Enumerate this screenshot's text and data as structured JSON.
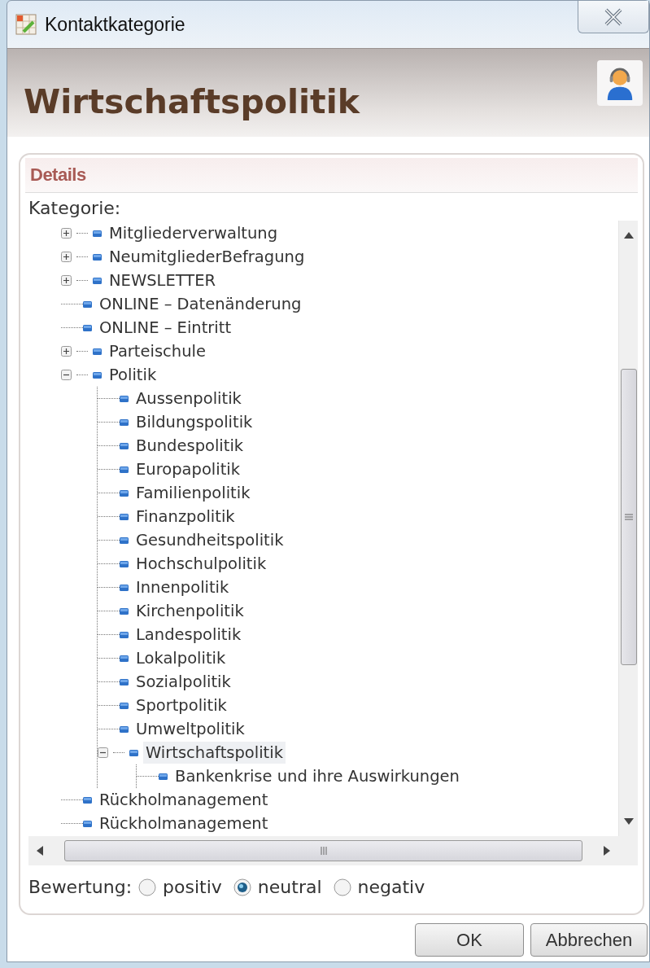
{
  "window": {
    "title": "Kontaktkategorie"
  },
  "header": {
    "title": "Wirtschaftspolitik"
  },
  "panel": {
    "title": "Details"
  },
  "tree": {
    "label": "Kategorie:",
    "items": [
      {
        "label": "Mitgliederverwaltung",
        "kind": "group",
        "expanded": false,
        "selected": false
      },
      {
        "label": "NeumitgliederBefragung",
        "kind": "group",
        "expanded": false,
        "selected": false
      },
      {
        "label": "NEWSLETTER",
        "kind": "group",
        "expanded": false,
        "selected": false
      },
      {
        "label": "ONLINE – Datenänderung",
        "kind": "leaf",
        "selected": false
      },
      {
        "label": "ONLINE – Eintritt",
        "kind": "leaf",
        "selected": false
      },
      {
        "label": "Parteischule",
        "kind": "group",
        "expanded": false,
        "selected": false
      },
      {
        "label": "Politik",
        "kind": "group",
        "expanded": true,
        "selected": false,
        "children": [
          {
            "label": "Aussenpolitik",
            "kind": "leaf",
            "selected": false
          },
          {
            "label": "Bildungspolitik",
            "kind": "leaf",
            "selected": false
          },
          {
            "label": "Bundespolitik",
            "kind": "leaf",
            "selected": false
          },
          {
            "label": "Europapolitik",
            "kind": "leaf",
            "selected": false
          },
          {
            "label": "Familienpolitik",
            "kind": "leaf",
            "selected": false
          },
          {
            "label": "Finanzpolitik",
            "kind": "leaf",
            "selected": false
          },
          {
            "label": "Gesundheitspolitik",
            "kind": "leaf",
            "selected": false
          },
          {
            "label": "Hochschulpolitik",
            "kind": "leaf",
            "selected": false
          },
          {
            "label": "Innenpolitik",
            "kind": "leaf",
            "selected": false
          },
          {
            "label": "Kirchenpolitik",
            "kind": "leaf",
            "selected": false
          },
          {
            "label": "Landespolitik",
            "kind": "leaf",
            "selected": false
          },
          {
            "label": "Lokalpolitik",
            "kind": "leaf",
            "selected": false
          },
          {
            "label": "Sozialpolitik",
            "kind": "leaf",
            "selected": false
          },
          {
            "label": "Sportpolitik",
            "kind": "leaf",
            "selected": false
          },
          {
            "label": "Umweltpolitik",
            "kind": "leaf",
            "selected": false
          },
          {
            "label": "Wirtschaftspolitik",
            "kind": "group",
            "expanded": true,
            "selected": true,
            "children": [
              {
                "label": "Bankenkrise und ihre Auswirkungen",
                "kind": "leaf",
                "selected": false
              }
            ]
          }
        ]
      },
      {
        "label": "Rückholmanagement",
        "kind": "leaf",
        "selected": false
      },
      {
        "label": "Rückholmanagement",
        "kind": "leaf",
        "selected": false
      }
    ]
  },
  "rating": {
    "label": "Bewertung:",
    "options": [
      {
        "label": "positiv",
        "selected": false
      },
      {
        "label": "neutral",
        "selected": true
      },
      {
        "label": "negativ",
        "selected": false
      }
    ]
  },
  "buttons": [
    {
      "label": "OK"
    },
    {
      "label": "Abbrechen"
    }
  ]
}
